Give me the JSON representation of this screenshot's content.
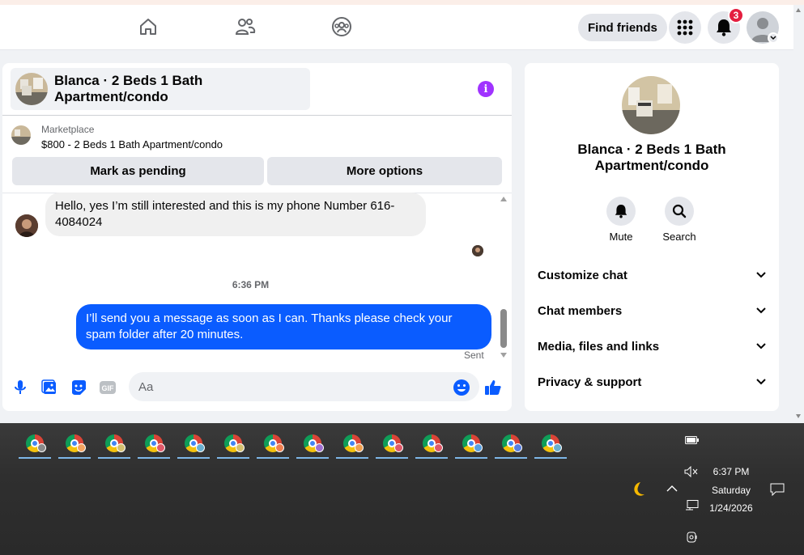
{
  "topbar": {
    "find_friends_label": "Find friends",
    "notification_count": "3"
  },
  "chat": {
    "title": "Blanca · 2 Beds 1 Bath Apartment/condo",
    "info_glyph": "i",
    "marketplace_label": "Marketplace",
    "listing_price_title": "$800 - 2 Beds 1 Bath Apartment/condo",
    "mark_pending_label": "Mark as pending",
    "more_options_label": "More options",
    "messages": [
      {
        "direction": "incoming",
        "text": "Hello, yes I’m still interested and this is my phone Number 616-4084024"
      },
      {
        "direction": "outgoing",
        "text": "I’ll send you a message as soon as I can. Thanks please check your spam folder after 20 minutes."
      }
    ],
    "timestamp": "6:36 PM",
    "sent_label": "Sent",
    "composer_placeholder": "Aa"
  },
  "side": {
    "title": "Blanca · 2 Beds 1 Bath Apartment/condo",
    "mute_label": "Mute",
    "search_label": "Search",
    "rows": [
      "Customize chat",
      "Chat members",
      "Media, files and links",
      "Privacy & support"
    ]
  },
  "taskbar": {
    "time": "6:37 PM",
    "day": "Saturday",
    "date": "1/24/2026",
    "chrome_profile_colors": [
      "#8a8a8a",
      "#f4a460",
      "#d4c070",
      "#e05a6a",
      "#6ab0d0",
      "#d4c070",
      "#f08050",
      "#a070d0",
      "#f0a050",
      "#e05a6a",
      "#e05a6a",
      "#5aa0e0",
      "#5a80e0",
      "#6ab0d0"
    ]
  },
  "colors": {
    "messenger_blue": "#0a5cff",
    "badge_red": "#e41e3f",
    "info_purple": "#a033ff"
  }
}
